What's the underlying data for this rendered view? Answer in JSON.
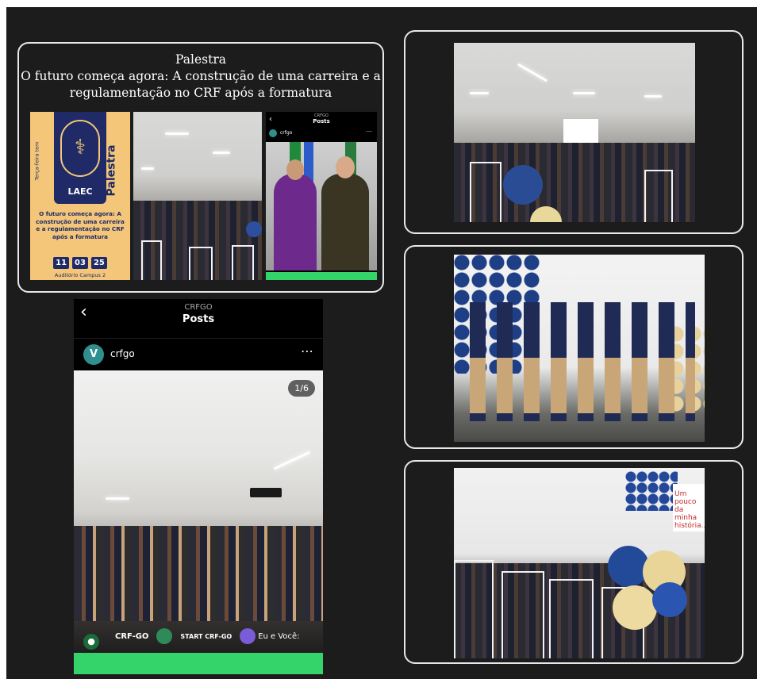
{
  "card_title": {
    "line1": "Palestra",
    "line2": "O futuro começa agora: A construção de uma carreira e a",
    "line3": "regulamentação no CRF após a formatura"
  },
  "poster": {
    "side_small": "Terça-feira tem",
    "side_big": "Palestra",
    "brand": "LAEC",
    "body": "O futuro começa agora: A construção de uma carreira e a regulamentação no CRF após a formatura",
    "day": "11",
    "month": "03",
    "year": "25",
    "venue": "Auditório Campus 2"
  },
  "phone_small": {
    "header_small": "CRFGO",
    "header_title": "Posts",
    "username": "crfgo"
  },
  "phone_big": {
    "header_small": "CRFGO",
    "header_title": "Posts",
    "username": "crfgo",
    "counter": "1/6",
    "logos": [
      "CRF-GO",
      "START CRF-GO",
      "Eu e Você:"
    ]
  },
  "photo_slide_text": "Um pouco da minha história..."
}
